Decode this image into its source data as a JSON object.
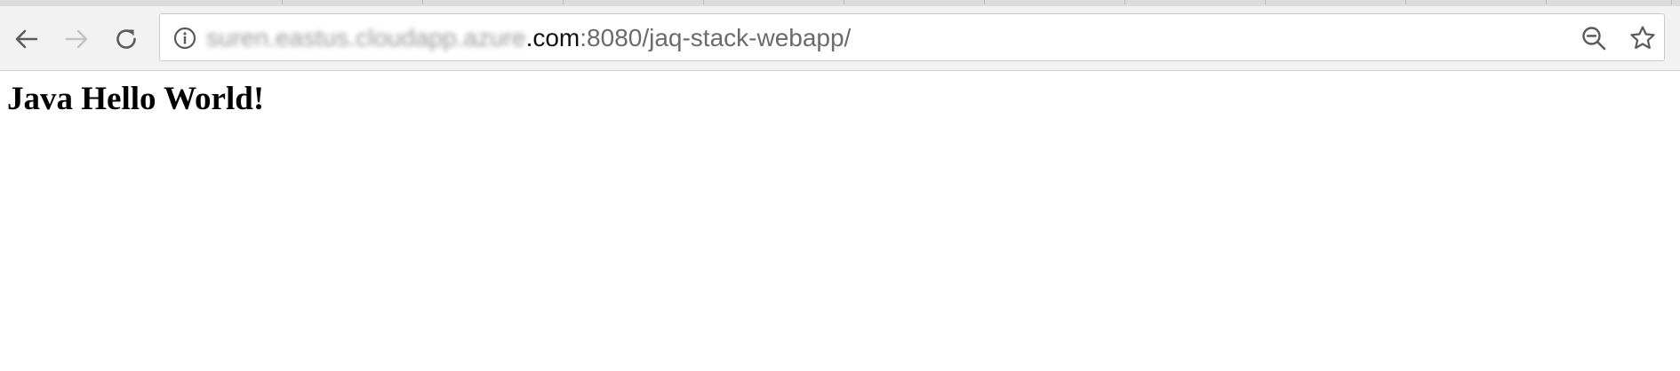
{
  "browser": {
    "address_bar": {
      "host_blurred": "suren.eastus.cloudapp.azure",
      "domain_suffix": ".com",
      "port_and_path": ":8080/jaq-stack-webapp/"
    },
    "icons": {
      "back": "back-arrow-icon",
      "forward": "forward-arrow-icon",
      "reload": "reload-icon",
      "info": "info-icon",
      "zoom": "zoom-out-icon",
      "bookmark": "star-icon"
    }
  },
  "page": {
    "heading": "Java Hello World!"
  },
  "colors": {
    "toolbar": "#f2f2f2",
    "tabstrip": "#dcdcdc",
    "icon": "#5a5a5a",
    "icon_disabled": "#c4c4c4"
  }
}
